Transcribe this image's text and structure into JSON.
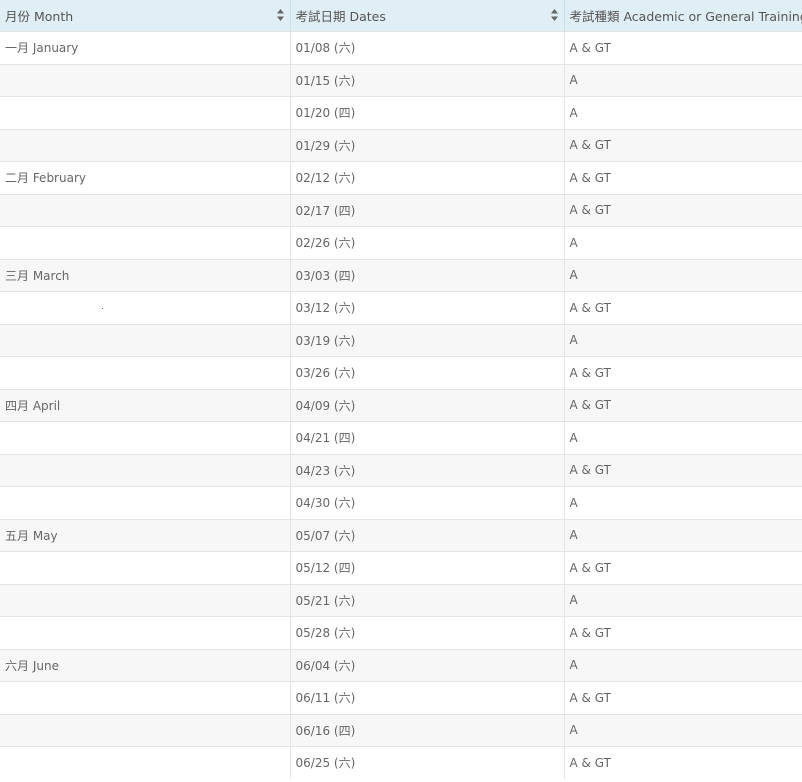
{
  "table": {
    "headers": [
      {
        "label": "月份 Month",
        "sortable": true
      },
      {
        "label": "考試日期 Dates",
        "sortable": true
      },
      {
        "label": "考試種類 Academic or General Training",
        "sortable": false
      }
    ],
    "rows": [
      {
        "month": "一月 January",
        "date": "01/08 (六)",
        "type": "A & GT"
      },
      {
        "month": "",
        "date": "01/15 (六)",
        "type": "A"
      },
      {
        "month": "",
        "date": "01/20 (四)",
        "type": "A"
      },
      {
        "month": "",
        "date": "01/29 (六)",
        "type": "A & GT"
      },
      {
        "month": "二月 February",
        "date": "02/12 (六)",
        "type": "A & GT"
      },
      {
        "month": "",
        "date": "02/17 (四)",
        "type": "A & GT"
      },
      {
        "month": "",
        "date": "02/26 (六)",
        "type": "A"
      },
      {
        "month": "三月 March",
        "date": "03/03 (四)",
        "type": "A"
      },
      {
        "month": "",
        "date": "03/12 (六)",
        "type": "A & GT"
      },
      {
        "month": "",
        "date": "03/19 (六)",
        "type": "A"
      },
      {
        "month": "",
        "date": "03/26 (六)",
        "type": "A & GT"
      },
      {
        "month": "四月 April",
        "date": "04/09 (六)",
        "type": "A & GT"
      },
      {
        "month": "",
        "date": "04/21 (四)",
        "type": "A"
      },
      {
        "month": "",
        "date": "04/23 (六)",
        "type": "A & GT"
      },
      {
        "month": "",
        "date": "04/30 (六)",
        "type": "A"
      },
      {
        "month": "五月 May",
        "date": "05/07 (六)",
        "type": "A"
      },
      {
        "month": "",
        "date": "05/12 (四)",
        "type": "A & GT"
      },
      {
        "month": "",
        "date": "05/21 (六)",
        "type": "A"
      },
      {
        "month": "",
        "date": "05/28 (六)",
        "type": "A & GT"
      },
      {
        "month": "六月 June",
        "date": "06/04 (六)",
        "type": "A"
      },
      {
        "month": "",
        "date": "06/11 (六)",
        "type": "A & GT"
      },
      {
        "month": "",
        "date": "06/16 (四)",
        "type": "A"
      },
      {
        "month": "",
        "date": "06/25 (六)",
        "type": "A & GT"
      }
    ]
  },
  "icons": {
    "sort": "sort-up-down-icon"
  },
  "colors": {
    "header_bg": "#e0eff5",
    "stripe_bg": "#f7f7f7",
    "text": "#555555"
  }
}
